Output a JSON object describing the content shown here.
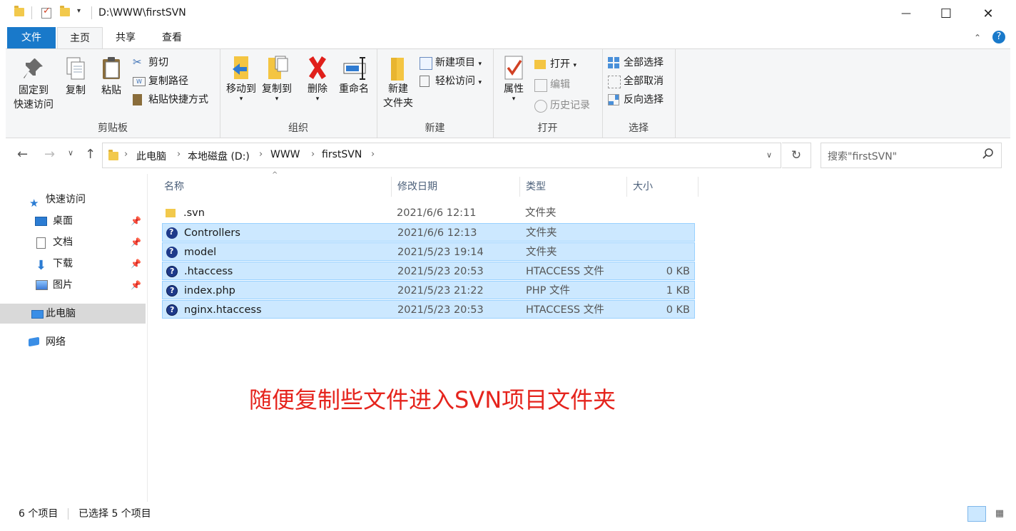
{
  "window": {
    "title": "D:\\WWW\\firstSVN",
    "minimize": "—",
    "maximize": "☐",
    "close": "✕"
  },
  "tabs": {
    "file": "文件",
    "home": "主页",
    "share": "共享",
    "view": "查看"
  },
  "help": "?",
  "ribbon": {
    "clipboard": {
      "label": "剪贴板",
      "pin_line1": "固定到",
      "pin_line2": "快速访问",
      "copy": "复制",
      "paste": "粘贴",
      "cut": "剪切",
      "copy_path": "复制路径",
      "paste_shortcut": "粘贴快捷方式"
    },
    "organize": {
      "label": "组织",
      "move_to": "移动到",
      "copy_to": "复制到",
      "delete": "删除",
      "rename": "重命名"
    },
    "new": {
      "label": "新建",
      "new_folder_line1": "新建",
      "new_folder_line2": "文件夹",
      "new_item": "新建项目",
      "easy_access": "轻松访问"
    },
    "open": {
      "label": "打开",
      "properties": "属性",
      "open": "打开",
      "edit": "编辑",
      "history": "历史记录"
    },
    "select": {
      "label": "选择",
      "select_all": "全部选择",
      "select_none": "全部取消",
      "invert": "反向选择"
    }
  },
  "address": {
    "crumbs": [
      "此电脑",
      "本地磁盘 (D:)",
      "WWW",
      "firstSVN"
    ],
    "search_placeholder": "搜索\"firstSVN\""
  },
  "nav": {
    "quick_access": "快速访问",
    "desktop": "桌面",
    "documents": "文档",
    "downloads": "下载",
    "pictures": "图片",
    "this_pc": "此电脑",
    "network": "网络"
  },
  "columns": {
    "name": "名称",
    "date": "修改日期",
    "type": "类型",
    "size": "大小"
  },
  "files": [
    {
      "name": ".svn",
      "date": "2021/6/6 12:11",
      "type": "文件夹",
      "size": "",
      "selected": false,
      "icon": "folder-icon"
    },
    {
      "name": "Controllers",
      "date": "2021/6/6 12:13",
      "type": "文件夹",
      "size": "",
      "selected": true,
      "icon": "svn-unversioned-folder-icon"
    },
    {
      "name": "model",
      "date": "2021/5/23 19:14",
      "type": "文件夹",
      "size": "",
      "selected": true,
      "icon": "svn-unversioned-folder-icon"
    },
    {
      "name": ".htaccess",
      "date": "2021/5/23 20:53",
      "type": "HTACCESS 文件",
      "size": "0 KB",
      "selected": true,
      "icon": "svn-unversioned-file-icon"
    },
    {
      "name": "index.php",
      "date": "2021/5/23 21:22",
      "type": "PHP 文件",
      "size": "1 KB",
      "selected": true,
      "icon": "svn-unversioned-file-icon"
    },
    {
      "name": "nginx.htaccess",
      "date": "2021/5/23 20:53",
      "type": "HTACCESS 文件",
      "size": "0 KB",
      "selected": true,
      "icon": "svn-unversioned-file-icon"
    }
  ],
  "annotation": "随便复制些文件进入SVN项目文件夹",
  "status": {
    "count": "6 个项目",
    "selected": "已选择 5 个项目"
  },
  "colors": {
    "accent": "#1979ca",
    "selection": "#cce8ff",
    "annotation": "#e5241d"
  }
}
